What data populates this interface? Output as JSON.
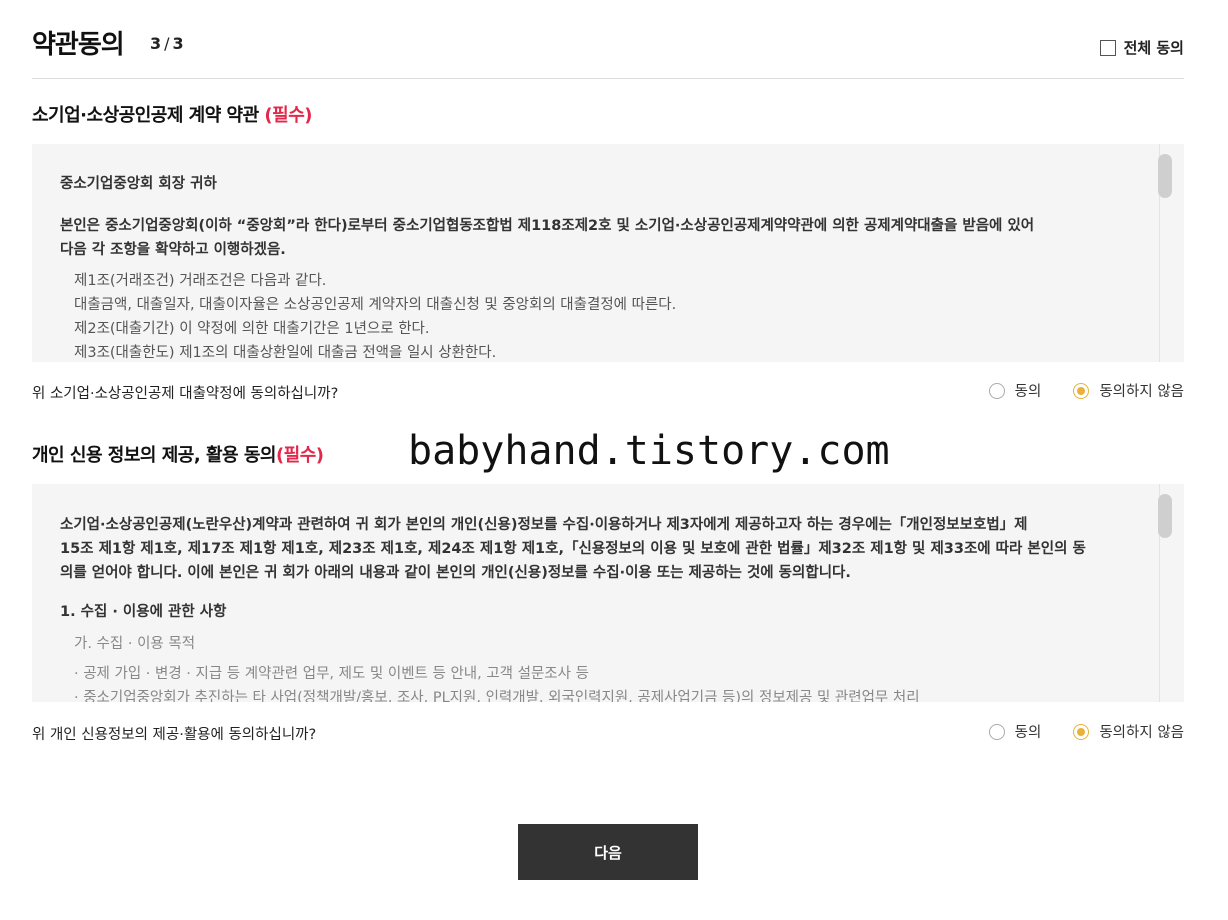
{
  "header": {
    "title": "약관동의",
    "step_current": "3",
    "step_total": "3",
    "agree_all_label": "전체 동의",
    "agree_all_checked": false
  },
  "sections": [
    {
      "title": "소기업·소상공인공제 계약 약관 ",
      "required": "(필수)",
      "lines": [
        {
          "style": "bold",
          "text": "중소기업중앙회 회장 귀하"
        },
        {
          "style": "bold",
          "text": "본인은 중소기업중앙회(이하 “중앙회”라 한다)로부터 중소기업협동조합법 제118조제2호 및 소기업·소상공인공제계약약관에 의한 공제계약대출을 받음에 있어"
        },
        {
          "style": "bold",
          "text": "다음 각 조항을 확약하고 이행하겠음."
        },
        {
          "style": "normal",
          "text": "제1조(거래조건) 거래조건은 다음과 같다."
        },
        {
          "style": "normal",
          "text": "대출금액, 대출일자, 대출이자율은 소상공인공제 계약자의 대출신청 및 중앙회의 대출결정에 따른다."
        },
        {
          "style": "normal",
          "text": "제2조(대출기간) 이 약정에 의한 대출기간은 1년으로 한다."
        },
        {
          "style": "normal",
          "text": "제3조(대출한도) 제1조의 대출상환일에 대출금 전액을 일시 상환한다."
        }
      ],
      "question": "위 소기업·소상공인공제 대출약정에 동의하십니까?",
      "agree_label": "동의",
      "disagree_label": "동의하지 않음",
      "selected": "disagree"
    },
    {
      "title": "개인 신용 정보의 제공, 활용 동의",
      "required": "(필수)",
      "lines": [
        {
          "style": "bold",
          "text": "소기업·소상공인공제(노란우산)계약과 관련하여 귀 회가 본인의 개인(신용)정보를 수집·이용하거나 제3자에게 제공하고자 하는 경우에는「개인정보보호법」제"
        },
        {
          "style": "bold",
          "text": "15조 제1항 제1호, 제17조 제1항 제1호, 제23조 제1호, 제24조 제1항 제1호,「신용정보의 이용 및 보호에 관한 법률」제32조 제1항 및 제33조에 따라 본인의 동"
        },
        {
          "style": "bold",
          "text": "의를 얻어야 합니다. 이에 본인은 귀 회가 아래의 내용과 같이 본인의 개인(신용)정보를 수집·이용 또는 제공하는 것에 동의합니다."
        },
        {
          "style": "bold",
          "text": "1. 수집 · 이용에 관한 사항"
        },
        {
          "style": "gray",
          "text": "가. 수집 · 이용 목적"
        },
        {
          "style": "gray",
          "text": "· 공제 가입 · 변경 · 지급 등 계약관련 업무, 제도 및 이벤트 등 안내, 고객 설문조사 등"
        },
        {
          "style": "gray",
          "text": "· 중소기업중앙회가 추진하는 타 사업(정책개발/홍보, 조사, PL지원, 인력개발, 외국인력지원, 공제사업기금 등)의 정보제공 및 관련업무 처리"
        }
      ],
      "question": "위 개인 신용정보의 제공·활용에 동의하십니까?",
      "agree_label": "동의",
      "disagree_label": "동의하지 않음",
      "selected": "disagree"
    }
  ],
  "watermark": "babyhand.tistory.com",
  "next_button_label": "다음",
  "colors": {
    "required": "#e3284b",
    "radio_selected": "#e8b23a",
    "button_bg": "#333333",
    "box_bg": "#f5f5f5"
  }
}
